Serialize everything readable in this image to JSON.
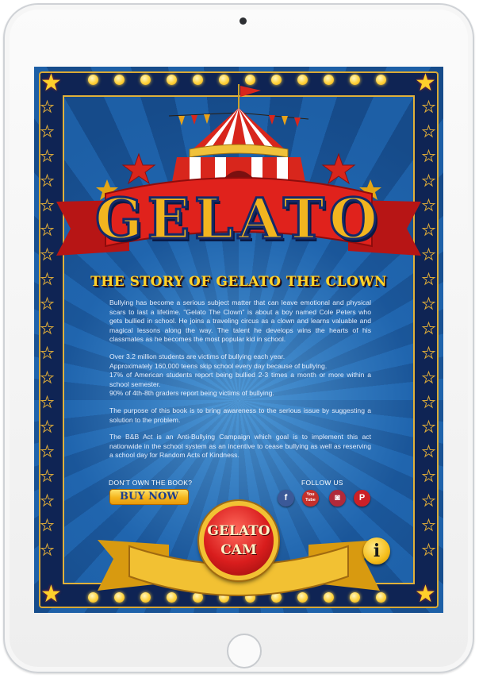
{
  "app": {
    "title": "GELATO",
    "subtitle": "THE STORY OF GELATO THE CLOWN"
  },
  "story": {
    "paragraph1": "Bullying has become a serious subject matter that can leave emotional and physical scars to last a lifetime. \"Gelato The Clown\" is about a boy named Cole Peters who gets bullied in school. He joins a traveling circus as a clown and learns valuable and magical lessons along the way. The talent he develops wins the hearts of his classmates as he becomes the most popular kid in school.",
    "stats": [
      "Over 3.2 million students are victims of bullying each year.",
      "Approximately 160,000 teens skip school every day because of bullying.",
      "17% of American students report being bullied 2-3 times a month or more within a school semester.",
      "90% of 4th-8th graders report being victims of bullying."
    ],
    "paragraph3": "The purpose of this book is to bring awareness to the serious issue by suggesting a solution to the problem.",
    "paragraph4": "The B&B Act is an Anti-Bullying Campaign which goal is to implement this act nationwide in the school system as an incentive to cease bullying as well as reserving a school day for Random Acts of Kindness."
  },
  "purchase": {
    "label": "DON'T OWN THE BOOK?",
    "button": "BUY NOW"
  },
  "social": {
    "label": "FOLLOW US",
    "icons": [
      {
        "name": "facebook-icon",
        "glyph": "f",
        "color": "#3b5998"
      },
      {
        "name": "youtube-icon",
        "glyph": "You Tube",
        "color": "#c4302b"
      },
      {
        "name": "instagram-icon",
        "glyph": "◙",
        "color": "#b02a3a"
      },
      {
        "name": "pinterest-icon",
        "glyph": "P",
        "color": "#cb2027"
      }
    ]
  },
  "cam_button": {
    "line1": "GELATO",
    "line2": "CAM"
  },
  "info_button": {
    "glyph": "i"
  },
  "colors": {
    "navy": "#0f2454",
    "gold": "#f2b51f",
    "red": "#d91d1d",
    "ray_blue": "#1d5fa6"
  }
}
